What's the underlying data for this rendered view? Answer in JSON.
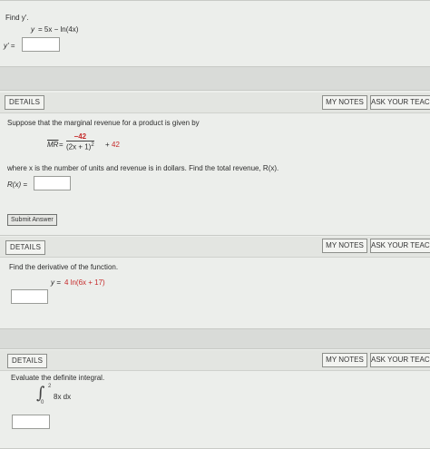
{
  "q1": {
    "prompt": "Find y'.",
    "equation_lhs": "y",
    "equation_rhs": "= 5x − ln(4x)",
    "answer_label": "y' ="
  },
  "q2": {
    "details_label": "DETAILS",
    "my_notes_label": "MY NOTES",
    "ask_label": "ASK YOUR TEACH",
    "intro": "Suppose that the marginal revenue for a product is given by",
    "mr_label": "MR",
    "mr_equals": "=",
    "numerator": "−42",
    "denominator": "(2x + 1)",
    "exponent": "2",
    "plus": "+",
    "constant": "42",
    "description": "where x is the number of units and revenue is in dollars. Find the total revenue, R(x).",
    "answer_label": "R(x) =",
    "submit_label": "Submit Answer"
  },
  "q3": {
    "details_label": "DETAILS",
    "my_notes_label": "MY NOTES",
    "ask_label": "ASK YOUR TEACH",
    "prompt": "Find the derivative of the function.",
    "eq_prefix": "y =",
    "eq_body": "4 ln(6x + 17)"
  },
  "q4": {
    "details_label": "DETAILS",
    "my_notes_label": "MY NOTES",
    "ask_label": "ASK YOUR TEACH",
    "prompt": "Evaluate the definite integral.",
    "integral_symbol": "∫",
    "upper_limit": "2",
    "lower_limit": "0",
    "integrand": "8x dx"
  }
}
